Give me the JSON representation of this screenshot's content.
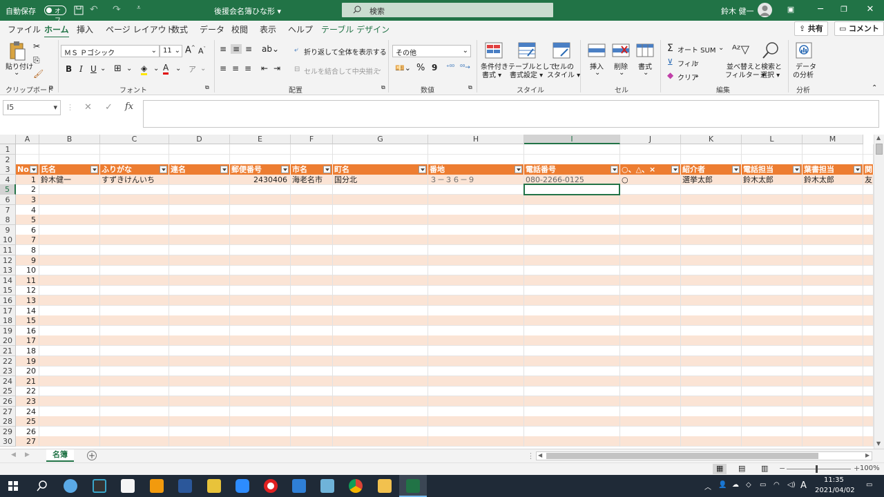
{
  "titlebar": {
    "autosave": "自動保存",
    "autosave_state": "オフ",
    "doc_title": "後援会名簿ひな形 ▾",
    "search_placeholder": "検索",
    "user_name": "鈴木 健一"
  },
  "tabs": [
    "ファイル",
    "ホーム",
    "挿入",
    "ページ レイアウト",
    "数式",
    "データ",
    "校閲",
    "表示",
    "ヘルプ",
    "テーブル デザイン"
  ],
  "active_tab": "ホーム",
  "top_buttons": {
    "share": "共有",
    "comment": "コメント"
  },
  "ribbon": {
    "clipboard": {
      "paste": "貼り付け",
      "label": "クリップボード"
    },
    "font": {
      "name": "ＭＳ Ｐゴシック",
      "size": "11",
      "label": "フォント",
      "bold": "B",
      "italic": "I",
      "underline": "U",
      "grow": "A",
      "shrink": "A"
    },
    "alignment": {
      "wrap": "折り返して全体を表示する",
      "merge": "セルを結合して中央揃え",
      "label": "配置"
    },
    "number": {
      "format": "その他",
      "percent": "%",
      "comma": "9",
      "label": "数値"
    },
    "styles": {
      "conditional": "条件付き\n書式",
      "conditional_1": "条件付き",
      "conditional_2": "書式 ▾",
      "table_1": "テーブルとして",
      "table_2": "書式設定 ▾",
      "cell_1": "セルの",
      "cell_2": "スタイル ▾",
      "label": "スタイル"
    },
    "cells": {
      "insert": "挿入",
      "delete": "削除",
      "format": "書式",
      "label": "セル"
    },
    "editing": {
      "autosum": "オート SUM",
      "fill": "フィル",
      "clear": "クリア",
      "sort_1": "並べ替えと",
      "sort_2": "フィルター ▾",
      "find_1": "検索と",
      "find_2": "選択 ▾",
      "label": "編集"
    },
    "analysis": {
      "data_1": "データ",
      "data_2": "の分析",
      "label": "分析"
    }
  },
  "formula": {
    "name_box": "I5",
    "fx": "fx",
    "cancel": "✕",
    "enter": "✓",
    "content": ""
  },
  "columns": [
    "A",
    "B",
    "C",
    "D",
    "E",
    "F",
    "G",
    "H",
    "I",
    "J",
    "K",
    "L",
    "M"
  ],
  "selected_column": "I",
  "selected_row": "5",
  "table_headers": [
    "No.",
    "氏名",
    "ふりがな",
    "連名",
    "郵便番号",
    "市名",
    "町名",
    "番地",
    "電話番号",
    "○、△、×",
    "紹介者",
    "電話担当",
    "葉書担当",
    "関"
  ],
  "record": {
    "no": "1",
    "name": "鈴木健一",
    "furigana": "すずきけんいち",
    "renmei": "",
    "postal": "2430406",
    "city": "海老名市",
    "town": "国分北",
    "address": "３－３６－９",
    "phone": "080-2266-0125",
    "mark": "○",
    "referrer": "選挙太郎",
    "phone_staff": "鈴木太郎",
    "postcard_staff": "鈴木太郎",
    "extra": "友"
  },
  "row_numbers": [
    "1",
    "2",
    "3",
    "4",
    "5",
    "6",
    "7",
    "8",
    "9",
    "10",
    "11",
    "12",
    "13",
    "14",
    "15",
    "16",
    "17",
    "18",
    "19",
    "20",
    "21",
    "22",
    "23",
    "24",
    "25",
    "26",
    "27",
    "28",
    "29",
    "30"
  ],
  "no_values": [
    "2",
    "3",
    "4",
    "5",
    "6",
    "7",
    "8",
    "9",
    "10",
    "11",
    "12",
    "13",
    "14",
    "15",
    "16",
    "17",
    "18",
    "19",
    "20",
    "21",
    "22",
    "23",
    "24",
    "25",
    "26",
    "27"
  ],
  "sheet": {
    "tab": "名簿",
    "add": "+"
  },
  "status": {
    "zoom": "100%"
  },
  "taskbar": {
    "time": "11:35",
    "date": "2021/04/02",
    "ime": "A"
  }
}
